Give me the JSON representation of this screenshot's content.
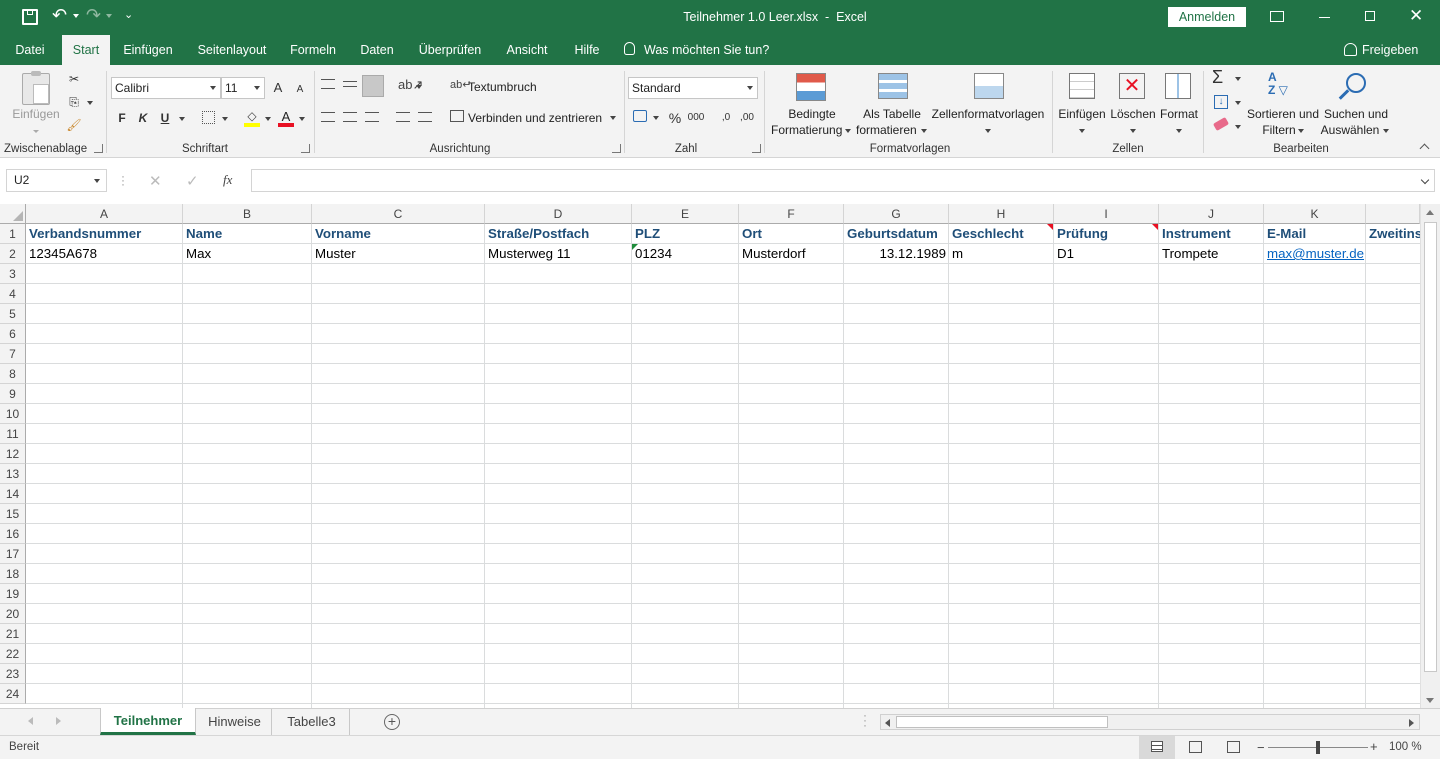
{
  "window": {
    "title": "Teilnehmer 1.0 Leer.xlsx  -  Excel",
    "signin": "Anmelden"
  },
  "ribbon_tabs": [
    "Datei",
    "Start",
    "Einfügen",
    "Seitenlayout",
    "Formeln",
    "Daten",
    "Überprüfen",
    "Ansicht",
    "Hilfe"
  ],
  "tell_me": "Was möchten Sie tun?",
  "share": "Freigeben",
  "groups": {
    "clipboard": "Zwischenablage",
    "font": "Schriftart",
    "alignment": "Ausrichtung",
    "number": "Zahl",
    "styles": "Formatvorlagen",
    "cells": "Zellen",
    "editing": "Bearbeiten"
  },
  "clipboard": {
    "paste": "Einfügen"
  },
  "font": {
    "name": "Calibri",
    "size": "11",
    "bold": "F",
    "italic": "K",
    "underline": "U",
    "grow": "A",
    "shrink": "A",
    "color": "A"
  },
  "alignment": {
    "wrap": "Textumbruch",
    "merge": "Verbinden und zentrieren"
  },
  "number": {
    "format": "Standard",
    "percent": "%",
    "thousands": "000",
    "inc": ",0",
    "dec": ",00"
  },
  "styles": {
    "cond1": "Bedingte",
    "cond2": "Formatierung",
    "table1": "Als Tabelle",
    "table2": "formatieren",
    "cellstyles": "Zellenformatvorlagen"
  },
  "cells": {
    "insert": "Einfügen",
    "delete": "Löschen",
    "format": "Format"
  },
  "editing": {
    "sort1": "Sortieren und",
    "sort2": "Filtern",
    "find1": "Suchen und",
    "find2": "Auswählen",
    "sum": "Σ"
  },
  "formula_bar": {
    "name_box": "U2",
    "fx": "fx",
    "formula": ""
  },
  "columns": [
    "A",
    "B",
    "C",
    "D",
    "E",
    "F",
    "G",
    "H",
    "I",
    "J",
    "K"
  ],
  "rows": [
    "1",
    "2",
    "3",
    "4",
    "5",
    "6",
    "7",
    "8",
    "9",
    "10",
    "11",
    "12",
    "13",
    "14",
    "15",
    "16",
    "17",
    "18",
    "19",
    "20",
    "21",
    "22",
    "23",
    "24"
  ],
  "headers": [
    "Verbandsnummer",
    "Name",
    "Vorname",
    "Straße/Postfach",
    "PLZ",
    "Ort",
    "Geburtsdatum",
    "Geschlecht",
    "Prüfung",
    "Instrument",
    "E-Mail",
    "Zweitins"
  ],
  "row2": [
    "12345A678",
    "Max",
    "Muster",
    "Musterweg 11",
    "01234",
    "Musterdorf",
    "13.12.1989",
    "m",
    "D1",
    "Trompete",
    "max@muster.de"
  ],
  "sheets": [
    "Teilnehmer",
    "Hinweise",
    "Tabelle3"
  ],
  "status": {
    "ready": "Bereit",
    "zoom": "100 %"
  },
  "colors": {
    "excel_green": "#217346",
    "header_text": "#1f4e78",
    "link": "#0563c1",
    "comment_red": "#e81123",
    "error_green": "#1e8c3a"
  }
}
